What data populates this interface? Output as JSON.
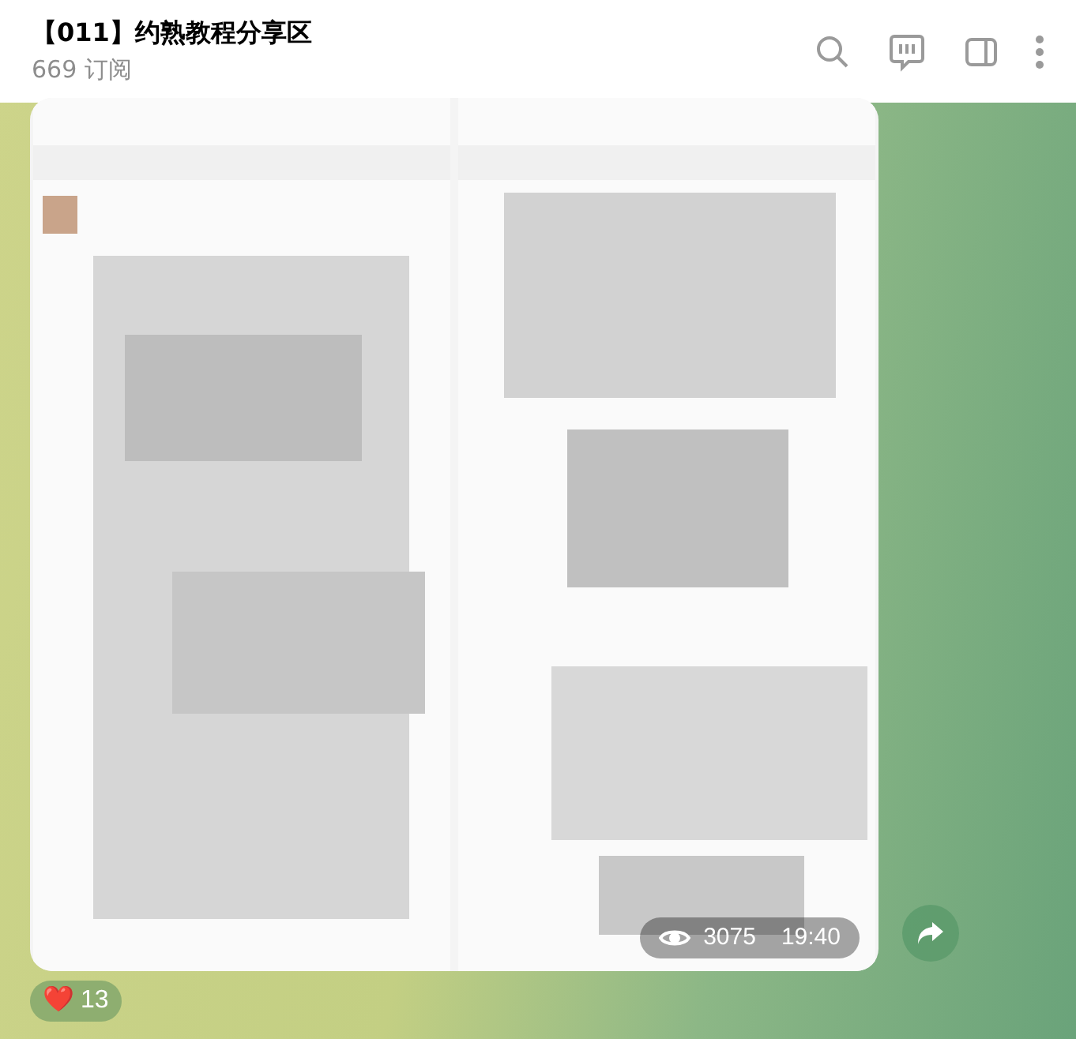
{
  "header": {
    "title": "【011】约熟教程分享区",
    "subtitle": "669 订阅"
  },
  "post": {
    "views": "3075",
    "time": "19:40"
  },
  "reactions": [
    {
      "emoji": "❤️",
      "count": "13",
      "selected": false
    }
  ]
}
